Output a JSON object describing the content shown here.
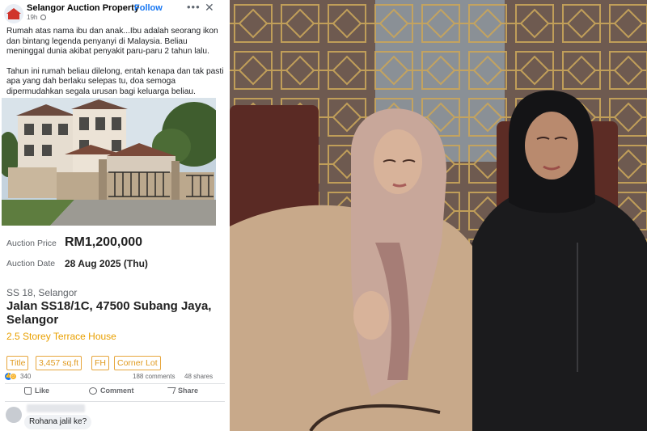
{
  "post": {
    "page_name": "Selangor Auction Property",
    "follow_label": "Follow",
    "time": "19h",
    "caption_p1": "Rumah atas nama ibu dan anak...Ibu adalah seorang ikon dan bintang legenda penyanyi di Malaysia. Beliau meninggal dunia akibat penyakit paru-paru 2 tahun lalu.",
    "caption_p2": "Tahun ini rumah beliau dilelong, entah kenapa dan tak pasti apa yang dah berlaku selepas tu, doa semoga dipermudahkan segala urusan bagi keluarga beliau.",
    "icons": [
      "globe-icon",
      "more-options-icon",
      "close-icon",
      "like-icon",
      "comment-icon",
      "share-icon"
    ]
  },
  "listing": {
    "auction_price_label": "Auction Price",
    "auction_price": "RM1,200,000",
    "auction_date_label": "Auction Date",
    "auction_date": "28 Aug 2025 (Thu)",
    "area": "SS 18, Selangor",
    "address": "Jalan SS18/1C, 47500 Subang Jaya, Selangor",
    "property_type": "2.5 Storey Terrace House",
    "tags": [
      "Title",
      "3,457 sq.ft",
      "FH",
      "Corner Lot"
    ],
    "accent_color": "#e9a000"
  },
  "engagement": {
    "reactions_count": "340",
    "comments": "188 comments",
    "shares": "48 shares",
    "like_label": "Like",
    "comment_label": "Comment",
    "share_label": "Share"
  },
  "comment": {
    "text": "Rohana jalil ke?"
  }
}
